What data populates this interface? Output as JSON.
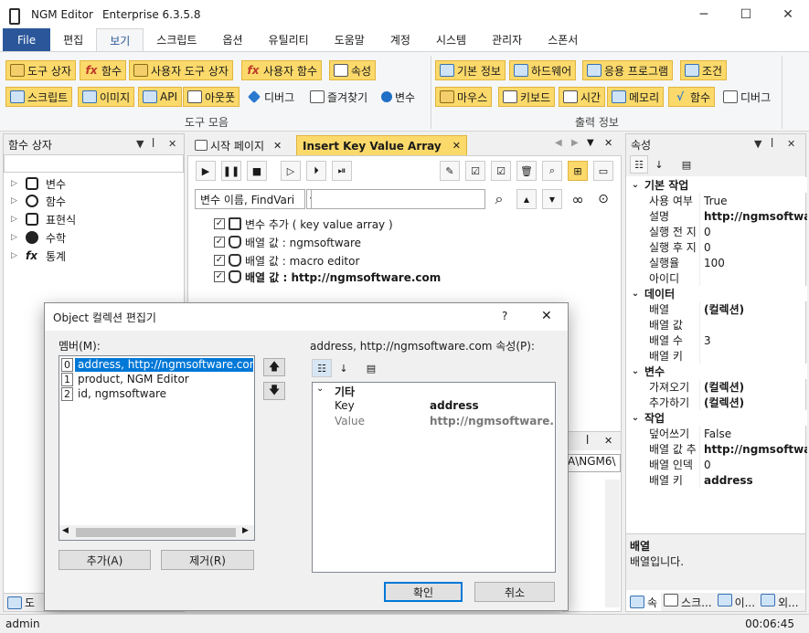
{
  "window": {
    "app_name": "NGM Editor",
    "edition": "Enterprise 6.3.5.8",
    "minimize": "─",
    "maximize": "☐",
    "close": "✕"
  },
  "ribbon_tabs": [
    "File",
    "편집",
    "보기",
    "스크립트",
    "옵션",
    "유틸리티",
    "도움말",
    "계정",
    "시스템",
    "관리자",
    "스폰서"
  ],
  "ribbon": {
    "tools_group": {
      "row1": [
        "도구 상자",
        "함수",
        "사용자 도구 상자",
        "사용자 함수",
        "속성"
      ],
      "row2": [
        "스크립트",
        "이미지",
        "API",
        "아웃풋",
        "디버그",
        "즐겨찾기",
        "변수"
      ],
      "label": "도구 모음"
    },
    "output_group": {
      "row1": [
        "기본 정보",
        "하드웨어",
        "응용 프로그램",
        "조건"
      ],
      "row2": [
        "마우스",
        "키보드",
        "시간",
        "메모리",
        "함수",
        "디버그"
      ],
      "label": "출력 정보"
    }
  },
  "left_panel": {
    "title": "함수 상자",
    "items": [
      "변수",
      "함수",
      "표현식",
      "수학",
      "통계"
    ],
    "bottom_tab": "도"
  },
  "doc_tabs": {
    "tab1": "시작 페이지",
    "tab2": "Insert Key Value Array"
  },
  "editor": {
    "search_select": "변수 이름, FindVari",
    "lines": [
      "변수 추가 ( key value array )",
      "배열 값 : ngmsoftware",
      "배열 값 : macro editor",
      "배열 값 : http://ngmsoftware.com"
    ],
    "output_partial": "A\\NGM6\\"
  },
  "right_panel": {
    "title": "속성",
    "categories": [
      {
        "name": "기본 작업",
        "rows": [
          [
            "사용 여부",
            "True"
          ],
          [
            "설명",
            "http://ngmsoftware"
          ],
          [
            "실행 전 지",
            "0"
          ],
          [
            "실행 후 지",
            "0"
          ],
          [
            "실행율",
            "100"
          ],
          [
            "아이디",
            ""
          ]
        ]
      },
      {
        "name": "데이터",
        "rows": [
          [
            "배열",
            "(컬렉션)"
          ],
          [
            "배열 값",
            ""
          ],
          [
            "배열 수",
            "3"
          ],
          [
            "배열 키",
            ""
          ]
        ]
      },
      {
        "name": "변수",
        "rows": [
          [
            "가져오기",
            "(컬렉션)"
          ],
          [
            "추가하기",
            "(컬렉션)"
          ]
        ]
      },
      {
        "name": "작업",
        "rows": [
          [
            "덮어쓰기",
            "False"
          ],
          [
            "배열 값 추",
            "http://ngmsoftware"
          ],
          [
            "배열 인덱",
            "0"
          ],
          [
            "배열 키",
            "address"
          ]
        ]
      }
    ],
    "desc_title": "배열",
    "desc_text": "배열입니다.",
    "bottom_tabs": [
      "속",
      "스크...",
      "이...",
      "외..."
    ]
  },
  "dialog": {
    "title": "Object 컬렉션 편집기",
    "help": "?",
    "close": "✕",
    "members_label": "멤버(M):",
    "members": [
      {
        "index": "0",
        "text": "address, http://ngmsoftware.com"
      },
      {
        "index": "1",
        "text": "product, NGM Editor"
      },
      {
        "index": "2",
        "text": "id, ngmsoftware"
      }
    ],
    "props_label": "address, http://ngmsoftware.com 속성(P):",
    "category": "기타",
    "props": [
      [
        "Key",
        "address"
      ],
      [
        "Value",
        "http://ngmsoftware.c"
      ]
    ],
    "add": "추가(A)",
    "remove": "제거(R)",
    "ok": "확인",
    "cancel": "취소"
  },
  "status": {
    "user": "admin",
    "time": "00:06:45"
  }
}
